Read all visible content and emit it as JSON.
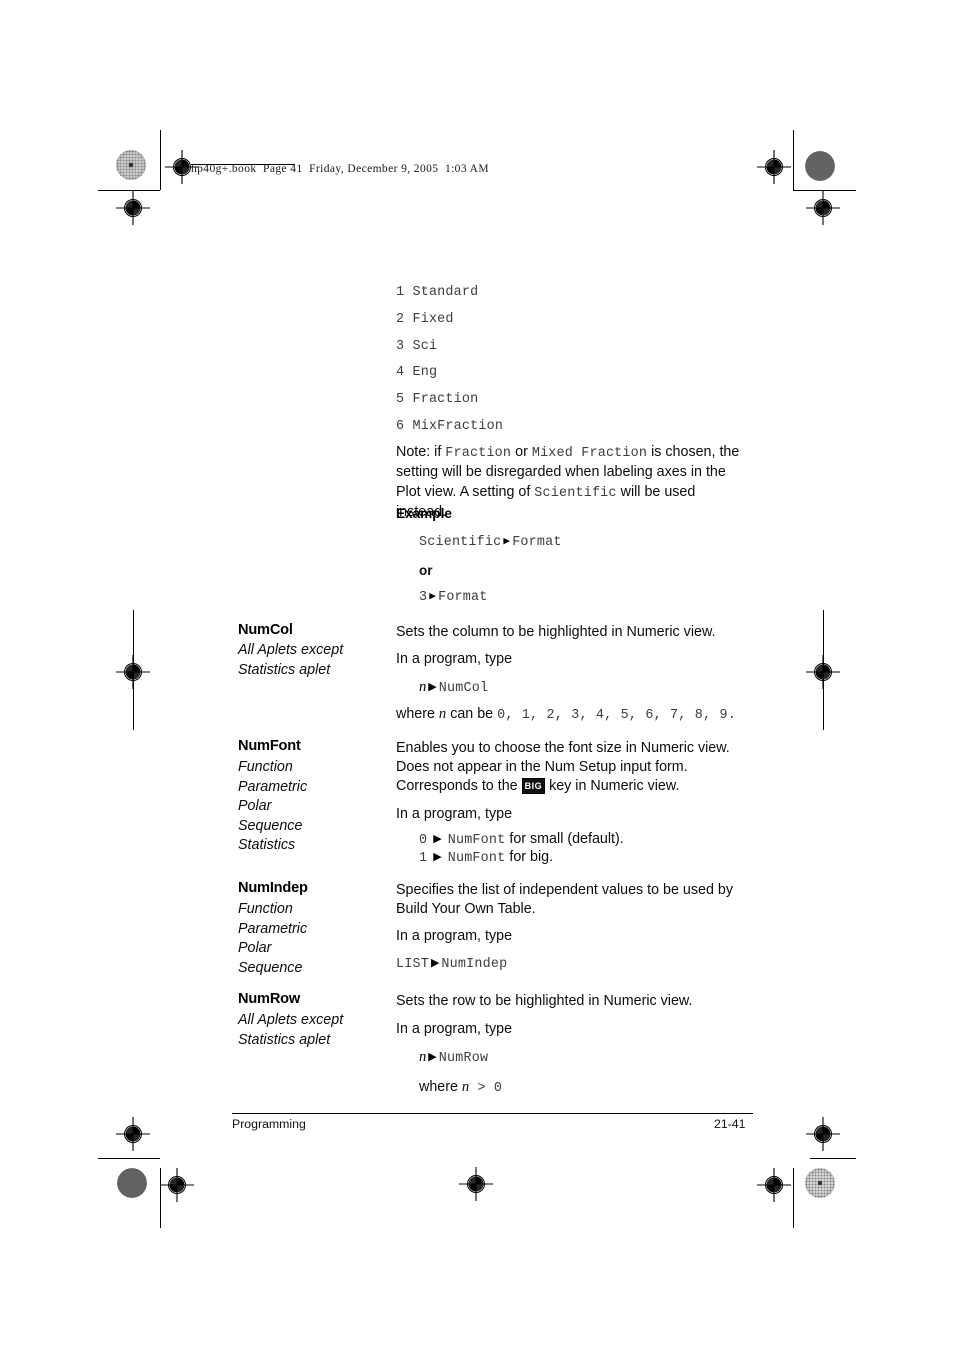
{
  "header": {
    "slug": "hp40g+.book  Page 41  Friday, December 9, 2005  1:03 AM"
  },
  "format_list": {
    "items": [
      "1 Standard",
      "2 Fixed",
      "3 Sci",
      "4 Eng",
      "5 Fraction",
      "6 MixFraction"
    ]
  },
  "note": {
    "p1_a": "Note: if ",
    "p1_code1": "Fraction",
    "p1_b": " or ",
    "p1_code2": "Mixed Fraction",
    "p1_c": " is chosen, the setting will be disregarded when labeling axes in the Plot view. A setting of ",
    "p1_code3": "Scientific",
    "p1_d": " will be used instead."
  },
  "example": {
    "label": "Example",
    "line1": "Scientific",
    "line1_target": "Format",
    "or": "or",
    "line2": "3",
    "line2_target": "Format"
  },
  "entries": [
    {
      "name": "NumCol",
      "aplets": [
        "All Aplets except",
        "Statistics aplet"
      ],
      "desc": "Sets the column to be highlighted in Numeric view.",
      "program_label": "In a program, type",
      "syntax_var": "n",
      "syntax_target": "NumCol",
      "where_prefix": "where ",
      "where_var": "n",
      "where_mid": " can be ",
      "where_values": "0, 1, 2, 3, 4, 5, 6, 7, 8, 9."
    },
    {
      "name": "NumFont",
      "aplets": [
        "Function",
        "Parametric",
        "Polar",
        "Sequence",
        "Statistics"
      ],
      "desc_l1": "Enables you to choose the font size in Numeric view.",
      "desc_l2": "Does not appear in the Num Setup input form.",
      "desc_l3a": "Corresponds to the ",
      "desc_key": "BIG",
      "desc_l3b": " key in Numeric view.",
      "program_label": "In a program, type",
      "opt0_num": "0",
      "opt0_target": "NumFont",
      "opt0_tail": " for small (default).",
      "opt1_num": "1",
      "opt1_target": "NumFont",
      "opt1_tail": " for big."
    },
    {
      "name": "NumIndep",
      "aplets": [
        "Function",
        "Parametric",
        "Polar",
        "Sequence"
      ],
      "desc_l1": "Specifies the list of independent values to be used by",
      "desc_l2": "Build Your Own Table.",
      "program_label": "In a program, type",
      "syntax_var": "LIST",
      "syntax_target": "NumIndep"
    },
    {
      "name": "NumRow",
      "aplets": [
        "All Aplets except",
        "Statistics aplet"
      ],
      "desc": "Sets the row to be highlighted in Numeric view.",
      "program_label": "In a program, type",
      "syntax_var": "n",
      "syntax_target": "NumRow",
      "where_prefix": "where ",
      "where_var": "n",
      "where_tail": " > 0"
    }
  ],
  "footer": {
    "left": "Programming",
    "right": "21-41"
  },
  "colors": {
    "text": "#0d0d0d",
    "code": "#3d3d3d",
    "rule": "#000000",
    "page_bg": "#ffffff"
  }
}
